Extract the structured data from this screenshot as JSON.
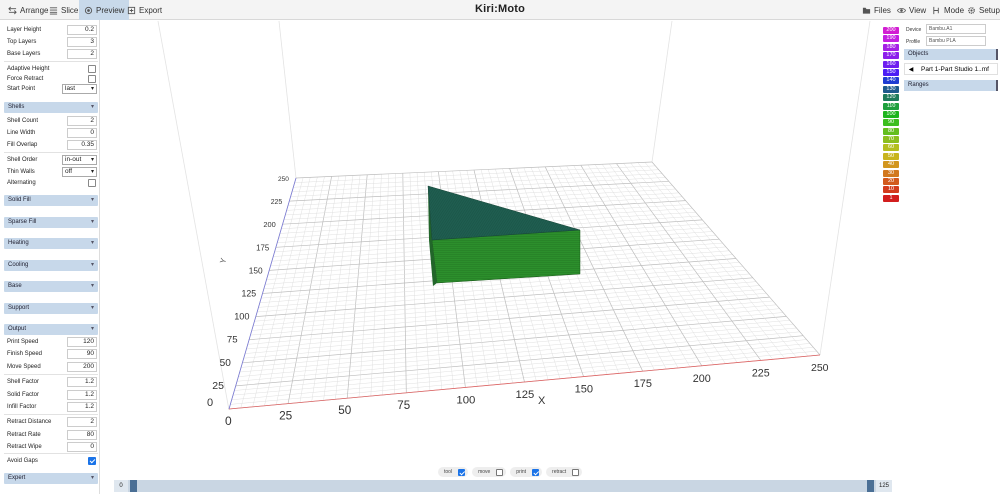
{
  "topbar": {
    "arrange": "Arrange",
    "slice": "Slice",
    "preview": "Preview",
    "export": "Export",
    "logo": "Kiri:Moto",
    "files": "Files",
    "view": "View",
    "mode": "Mode",
    "setup": "Setup"
  },
  "settings": {
    "layer_height": {
      "label": "Layer Height",
      "value": "0.2"
    },
    "top_layers": {
      "label": "Top Layers",
      "value": "3"
    },
    "base_layers": {
      "label": "Base Layers",
      "value": "2"
    },
    "adaptive_height": {
      "label": "Adaptive Height",
      "checked": false
    },
    "force_retract": {
      "label": "Force Retract",
      "checked": false
    },
    "start_point": {
      "label": "Start Point",
      "value": "last"
    },
    "shells_header": "Shells",
    "shell_count": {
      "label": "Shell Count",
      "value": "2"
    },
    "line_width": {
      "label": "Line Width",
      "value": "0"
    },
    "fill_overlap": {
      "label": "Fill Overlap",
      "value": "0.35"
    },
    "shell_order": {
      "label": "Shell Order",
      "value": "in-out"
    },
    "thin_walls": {
      "label": "Thin Walls",
      "value": "off"
    },
    "alternating": {
      "label": "Alternating",
      "checked": false
    },
    "solid_fill_header": "Solid Fill",
    "sparse_fill_header": "Sparse Fill",
    "heating_header": "Heating",
    "cooling_header": "Cooling",
    "base_header": "Base",
    "support_header": "Support",
    "output_header": "Output",
    "print_speed": {
      "label": "Print Speed",
      "value": "120"
    },
    "finish_speed": {
      "label": "Finish Speed",
      "value": "90"
    },
    "move_speed": {
      "label": "Move Speed",
      "value": "200"
    },
    "shell_factor": {
      "label": "Shell Factor",
      "value": "1.2"
    },
    "solid_factor": {
      "label": "Solid Factor",
      "value": "1.2"
    },
    "infill_factor": {
      "label": "Infill Factor",
      "value": "1.2"
    },
    "retract_distance": {
      "label": "Retract Distance",
      "value": "2"
    },
    "retract_rate": {
      "label": "Retract Rate",
      "value": "80"
    },
    "retract_wipe": {
      "label": "Retract Wipe",
      "value": "0"
    },
    "avoid_gaps": {
      "label": "Avoid Gaps",
      "checked": true
    },
    "expert_header": "Expert"
  },
  "legend": [
    {
      "label": "200",
      "color": "#d21ed2"
    },
    {
      "label": "190",
      "color": "#c31ee1"
    },
    {
      "label": "180",
      "color": "#a51ee6"
    },
    {
      "label": "170",
      "color": "#8c1eeb"
    },
    {
      "label": "160",
      "color": "#6e1ef0"
    },
    {
      "label": "150",
      "color": "#4b1ef5"
    },
    {
      "label": "140",
      "color": "#1e3cd2"
    },
    {
      "label": "130",
      "color": "#1e5a8c"
    },
    {
      "label": "120",
      "color": "#1e7a5a"
    },
    {
      "label": "110",
      "color": "#1ea03c"
    },
    {
      "label": "100",
      "color": "#1eb41e"
    },
    {
      "label": "90",
      "color": "#3cbe1e"
    },
    {
      "label": "80",
      "color": "#64be1e"
    },
    {
      "label": "70",
      "color": "#8cbe1e"
    },
    {
      "label": "60",
      "color": "#b4be1e"
    },
    {
      "label": "50",
      "color": "#c8b41e"
    },
    {
      "label": "40",
      "color": "#d2961e"
    },
    {
      "label": "30",
      "color": "#d2781e"
    },
    {
      "label": "20",
      "color": "#d25a1e"
    },
    {
      "label": "10",
      "color": "#d23c1e"
    },
    {
      "label": "1",
      "color": "#d21e1e"
    }
  ],
  "device": {
    "label": "Device",
    "value": "Bambu.A1"
  },
  "profile": {
    "label": "Profile",
    "value": "Bambu PLA"
  },
  "objects": {
    "header": "Objects",
    "item": "Part 1-Part Studio 1..mf"
  },
  "ranges": {
    "header": "Ranges"
  },
  "toggles": [
    {
      "label": "tool",
      "checked": true
    },
    {
      "label": "move",
      "checked": false
    },
    {
      "label": "print",
      "checked": true
    },
    {
      "label": "retract",
      "checked": false
    }
  ],
  "layer_slider": {
    "min": "0",
    "max": "125",
    "position_fraction": 1.0
  },
  "bed": {
    "x_axis_label": "X",
    "y_axis_label": "Y",
    "x_ticks": [
      "0",
      "25",
      "50",
      "75",
      "100",
      "125",
      "150",
      "175",
      "200",
      "225",
      "250"
    ],
    "y_ticks": [
      "25",
      "50",
      "75",
      "100",
      "125",
      "150",
      "175",
      "200",
      "225",
      "250"
    ]
  },
  "colors": {
    "accent": "#c7d8ea",
    "object_top": "#1e5a4e",
    "object_side": "#2a8a2a"
  }
}
